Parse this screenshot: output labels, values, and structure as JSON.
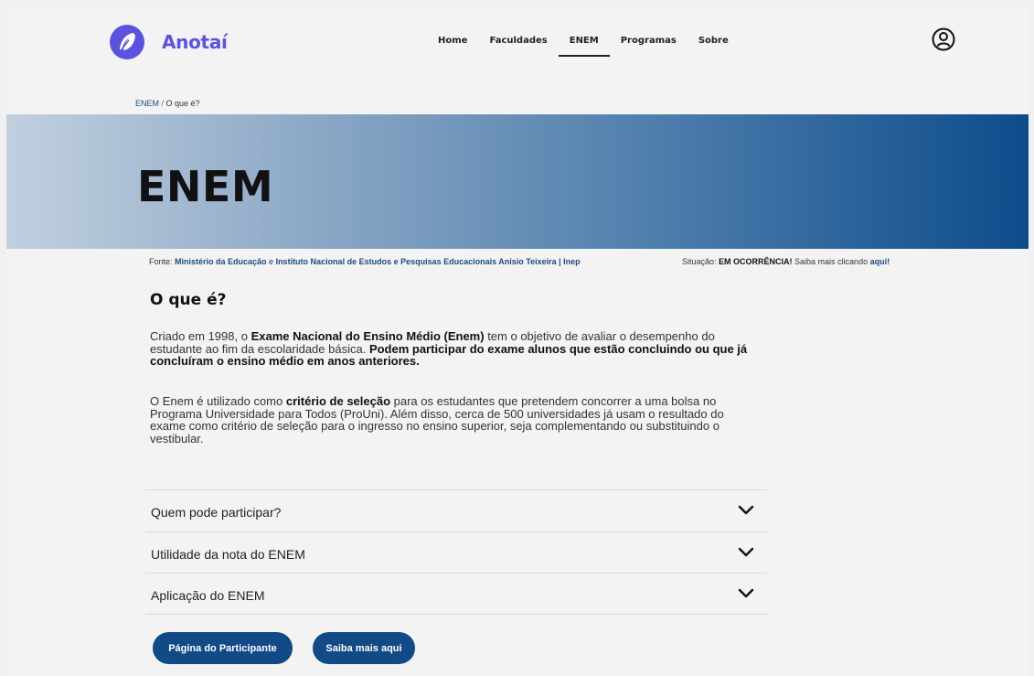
{
  "brand": {
    "name": "Anotaí",
    "icon": "feather-icon",
    "color": "#5b53e0"
  },
  "nav": {
    "items": [
      {
        "label": "Home"
      },
      {
        "label": "Faculdades"
      },
      {
        "label": "ENEM",
        "active": true
      },
      {
        "label": "Programas"
      },
      {
        "label": "Sobre"
      }
    ],
    "profile_icon": "user-circle-icon"
  },
  "breadcrumb": {
    "parent": "ENEM",
    "separator": " / ",
    "current": "O que é?"
  },
  "hero": {
    "title": "ENEM"
  },
  "source": {
    "prefix": "Fonte: ",
    "org1": "Ministério da Educação",
    "conj": " e ",
    "org2": "Instituto Nacional de Estudos e Pesquisas Educacionais Anísio Teixeira | Inep"
  },
  "status": {
    "prefix": "Situação: ",
    "value": "EM OCORRÊNCIA!",
    "middle": " Saiba mais clicando ",
    "link": "aqui!"
  },
  "section": {
    "title": "O que é?",
    "p1": {
      "a": "Criado em 1998, o ",
      "b": "Exame Nacional do Ensino Médio (Enem)",
      "c": " tem o objetivo de avaliar o desempenho do estudante ao fim da escolaridade básica. ",
      "d": "Podem participar do exame alunos que estão concluindo ou que já concluíram o ensino médio em anos anteriores."
    },
    "p2": {
      "a": "O Enem é utilizado como ",
      "b": "critério de seleção",
      "c": " para os estudantes que pretendem concorrer a uma bolsa no Programa Universidade para Todos (ProUni). Além disso, cerca de 500 universidades já usam o resultado do exame como critério de seleção para o ingresso no ensino superior, seja complementando ou substituindo o vestibular."
    }
  },
  "accordion": [
    {
      "label": "Quem pode participar?",
      "icon": "chevron-down-icon"
    },
    {
      "label": "Utilidade da nota do ENEM",
      "icon": "chevron-down-icon"
    },
    {
      "label": "Aplicação do ENEM",
      "icon": "chevron-down-icon"
    }
  ],
  "buttons": {
    "participant": "Página do Participante",
    "more": "Saiba mais aqui"
  },
  "colors": {
    "accent": "#114a87",
    "link": "#1f4a80",
    "brand": "#5b53e0"
  }
}
